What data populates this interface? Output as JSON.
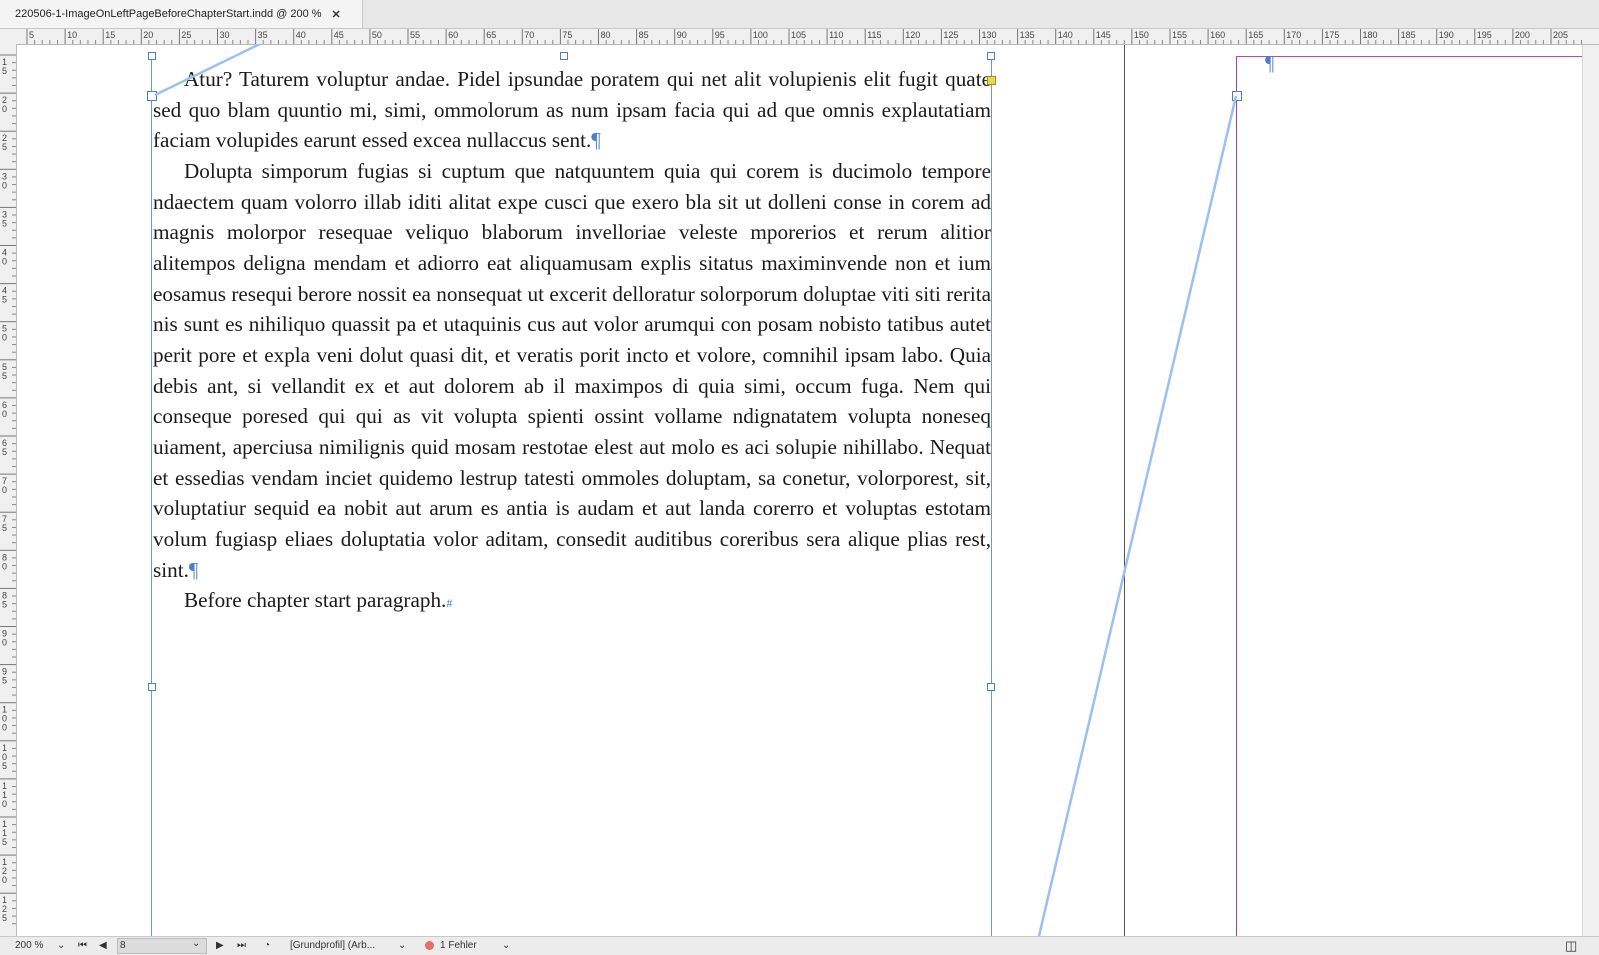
{
  "tab": {
    "title": "220506-1-ImageOnLeftPageBeforeChapterStart.indd @ 200 %",
    "close": "✕"
  },
  "ruler_h_labels": [
    "5",
    "10",
    "15",
    "20",
    "25",
    "30",
    "35",
    "40",
    "45",
    "50",
    "55",
    "60",
    "65",
    "70",
    "75",
    "80",
    "85",
    "90",
    "95",
    "100",
    "105",
    "110",
    "115",
    "120",
    "125",
    "130",
    "135",
    "140",
    "145",
    "150",
    "155",
    "160",
    "165",
    "170",
    "175",
    "180",
    "185",
    "190",
    "195",
    "200",
    "205"
  ],
  "ruler_v_labels": [
    "15",
    "20",
    "25",
    "30",
    "35",
    "40",
    "45",
    "50",
    "55",
    "60",
    "65",
    "70",
    "75",
    "80",
    "85",
    "90",
    "95",
    "100",
    "105",
    "110",
    "115",
    "120",
    "125"
  ],
  "story": {
    "paragraphs": [
      "Atur? Taturem voluptur andae. Pidel ipsundae poratem qui net alit volupienis elit fugit quate sed quo blam quuntio mi, simi, ommolorum as num ipsam facia qui ad que omnis explautatiam faciam volupides earunt essed excea nullaccus sent.",
      "Dolupta simporum fugias si cuptum que natquuntem quia qui corem is ducimolo tempore ndaectem quam volorro illab iditi alitat expe cusci que exero bla sit ut dolleni conse in corem ad magnis molorpor resequae veliquo blaborum invelloriae veleste mporerios et rerum alitior alitempos deligna mendam et adiorro eat aliquamusam explis sitatus maximinvende non et ium eosamus resequi berore nossit ea nonsequat ut excerit delloratur solorporum doluptae viti siti rerita nis sunt es nihiliquo quassit pa et utaquinis cus aut volor arumqui con posam nobisto tatibus autet perit pore et expla veni dolut quasi dit, et veratis porit incto et volore, comnihil ipsam labo. Quia debis ant, si vellandit ex et aut dolorem ab il maximpos di quia simi, occum fuga. Nem qui conseque poresed qui qui as vit volupta spienti ossint vollame ndignatatem volupta noneseq uiament, aperciusa nimilignis quid mosam restotae elest aut molo es aci solupie nihillabo. Nequat et essedias vendam inciet quidemo lestrup tatesti ommoles doluptam, sa conetur, volorporest, sit, voluptatiur sequid ea nobit aut arum es antia is audam et aut landa corerro et voluptas estotam volum fugiasp eliaes doluptatia volor aditam, consedit auditibus coreribus sera alique plias rest, sint.",
      "Before chapter start paragraph."
    ],
    "pilcrow": "¶",
    "end_of_story": "#"
  },
  "right_page": {
    "pilcrow": "¶"
  },
  "status": {
    "zoom": "200 %",
    "page": "8",
    "profile": "[Grundprofil] (Arb...",
    "errors": "1 Fehler"
  },
  "colors": {
    "frame": "#6a98d6",
    "thread": "#9cc0ee",
    "margin_guide": "#9b3fbf",
    "error": "#e86b6b"
  }
}
